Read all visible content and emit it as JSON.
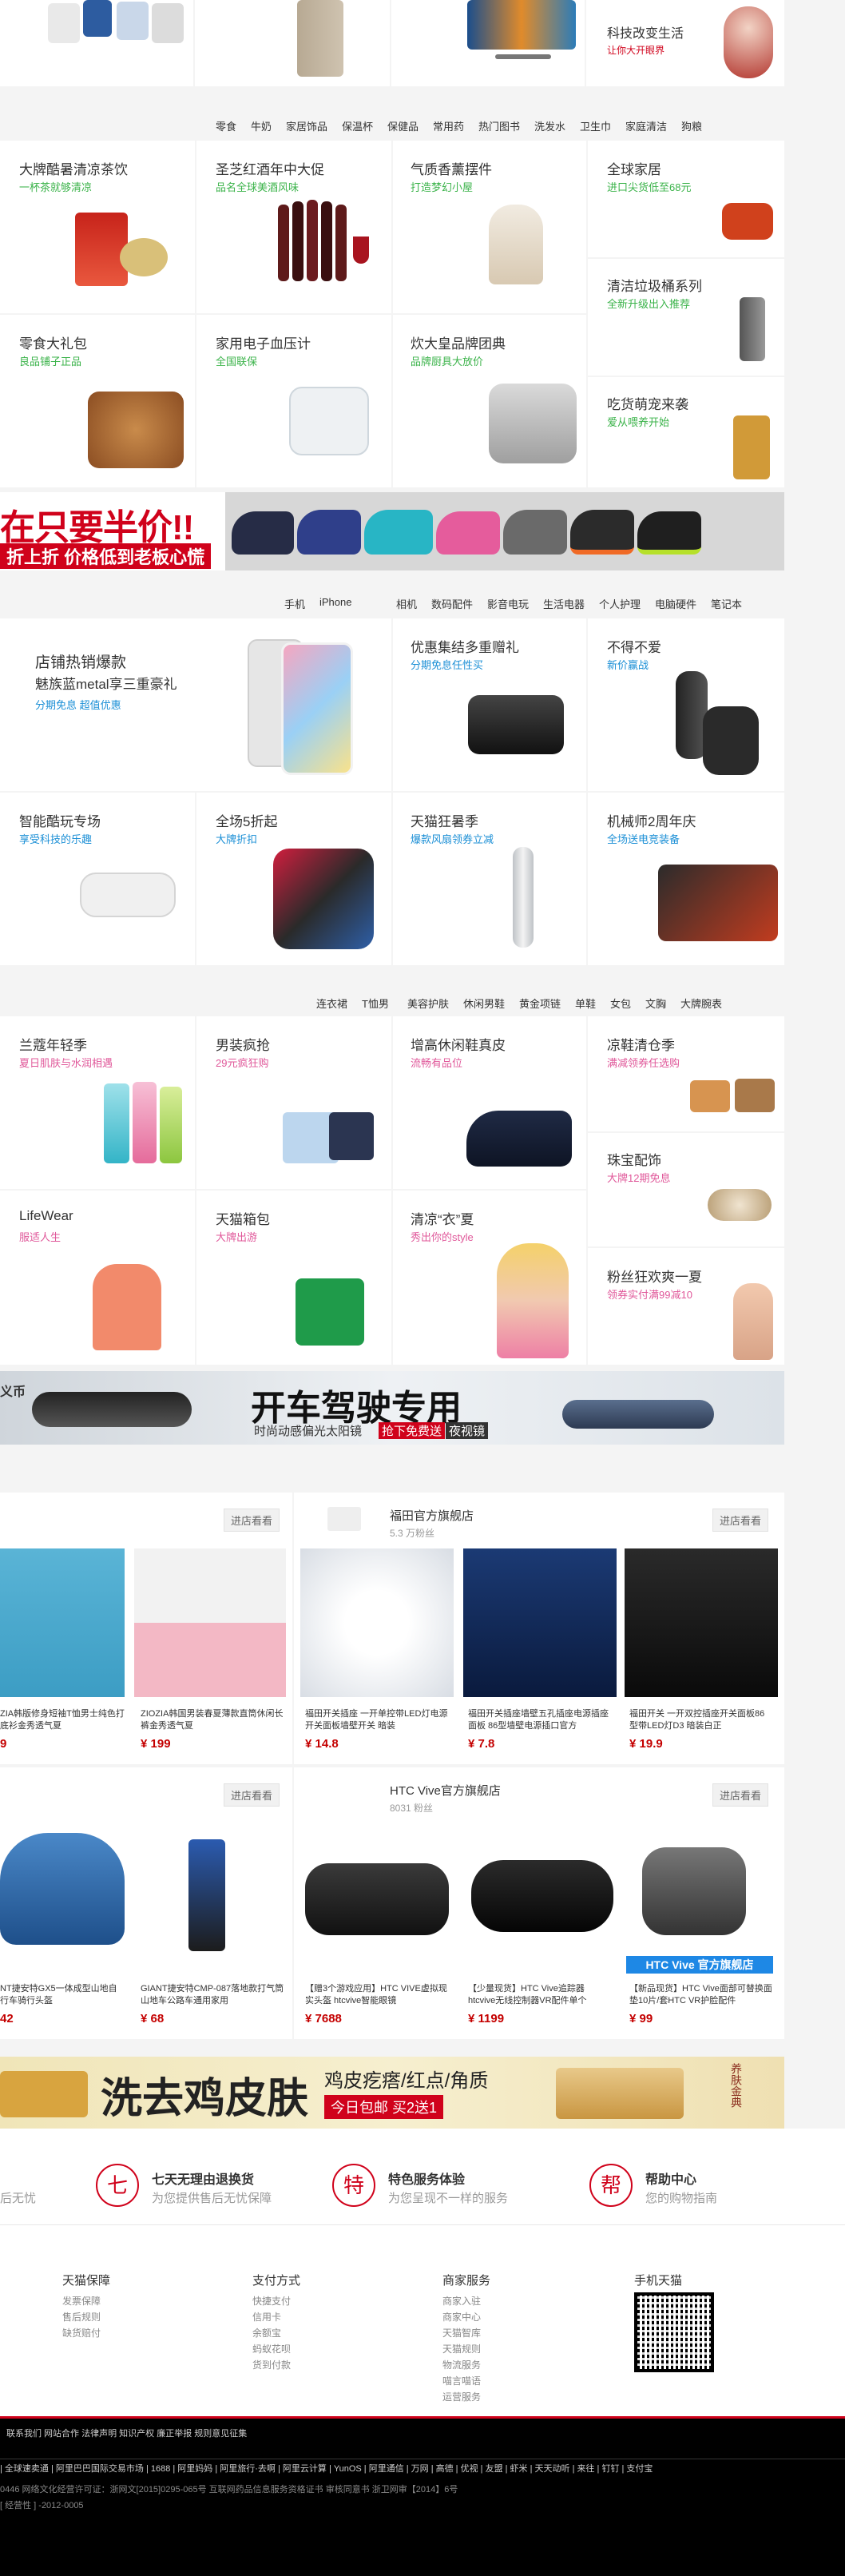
{
  "top_banner": {
    "title": "科技改变生活",
    "subtitle": "让你大开眼界"
  },
  "row1_cats": [
    "零食",
    "牛奶",
    "家居饰品",
    "保温杯",
    "保健品",
    "常用药",
    "热门图书",
    "洗发水",
    "卫生巾",
    "家庭清洁",
    "狗粮"
  ],
  "grid1": [
    {
      "title": "大牌酷暑清凉茶饮",
      "sub": "一杯茶就够清凉"
    },
    {
      "title": "圣芝红酒年中大促",
      "sub": "品名全球美酒风味"
    },
    {
      "title": "气质香薰摆件",
      "sub": "打造梦幻小屋"
    },
    {
      "title": "全球家居",
      "sub": "进口尖货低至68元"
    },
    {
      "title": "清洁垃圾桶系列",
      "sub": "全新升级出入推荐"
    },
    {
      "title": "零食大礼包",
      "sub": "良品铺子正品"
    },
    {
      "title": "家用电子血压计",
      "sub": "全国联保"
    },
    {
      "title": "炊大皇品牌团典",
      "sub": "品牌厨具大放价"
    },
    {
      "title": "吃货萌宠来袭",
      "sub": "爱从喂养开始"
    }
  ],
  "shoe_banner": {
    "line1": "在只要半价!!",
    "line2": "折上折 价格低到老板心慌"
  },
  "row2_cats": [
    "手机",
    "iPhone",
    "相机",
    "数码配件",
    "影音电玩",
    "生活电器",
    "个人护理",
    "电脑硬件",
    "笔记本"
  ],
  "grid2": [
    {
      "title": "店铺热销爆款",
      "title2": "魅族蓝metal享三重豪礼",
      "sub": "分期免息 超值优惠"
    },
    {
      "title": "优惠集结多重赠礼",
      "sub": "分期免息任性买"
    },
    {
      "title": "不得不爱",
      "sub": "新价赢战"
    },
    {
      "title": "智能酷玩专场",
      "sub": "享受科技的乐趣"
    },
    {
      "title": "全场5折起",
      "sub": "大牌折扣"
    },
    {
      "title": "天猫狂暑季",
      "sub": "爆款风扇领券立减"
    },
    {
      "title": "机械师2周年庆",
      "sub": "全场送电竞装备"
    }
  ],
  "row3_cats": [
    "连衣裙",
    "T恤男",
    "美容护肤",
    "休闲男鞋",
    "黄金项链",
    "单鞋",
    "女包",
    "文胸",
    "大牌腕表"
  ],
  "grid3": [
    {
      "title": "兰蔻年轻季",
      "sub": "夏日肌肤与水润相遇"
    },
    {
      "title": "男装疯抢",
      "sub": "29元疯狂购"
    },
    {
      "title": "增高休闲鞋真皮",
      "sub": "流畅有品位"
    },
    {
      "title": "凉鞋清仓季",
      "sub": "满减领券任选购"
    },
    {
      "title": "珠宝配饰",
      "sub": "大牌12期免息"
    },
    {
      "title": "LifeWear",
      "sub": "服适人生"
    },
    {
      "title": "天猫箱包",
      "sub": "大牌出游"
    },
    {
      "title": "清凉“衣”夏",
      "sub": "秀出你的style"
    },
    {
      "title": "粉丝狂欢爽一夏",
      "sub": "领券实付满99减10"
    }
  ],
  "drive_banner": {
    "title": "开车驾驶专用",
    "sub": "时尚动感偏光太阳镜",
    "tag": "抢下免费送",
    "tag2": "夜视镜",
    "left": "义币"
  },
  "shops": [
    {
      "name": "",
      "fans": "",
      "btn": "进店看看",
      "products": [
        {
          "desc": "ZIA韩版修身短袖T恤男士纯色打底衫金秀透气夏",
          "price": "9"
        },
        {
          "desc": "ZIOZIA韩国男装春夏薄款直筒休闲长裤金秀透气夏",
          "price": "¥ 199"
        }
      ]
    },
    {
      "name": "福田官方旗舰店",
      "fans": "5.3 万粉丝",
      "btn": "进店看看",
      "products": [
        {
          "desc": "福田开关插座 一开单控带LED灯电源开关面板墙壁开关 暗装",
          "price": "¥ 14.8"
        },
        {
          "desc": "福田开关插座墙壁五孔插座电源插座面板 86型墙壁电源插口官方",
          "price": "¥ 7.8"
        },
        {
          "desc": "福田开关 一开双控插座开关面板86型带LED灯D3 暗装白正",
          "price": "¥ 19.9"
        }
      ]
    },
    {
      "name": "",
      "fans": "",
      "btn": "进店看看",
      "products": [
        {
          "desc": "NT捷安特GX5一体成型山地自行车骑行头盔",
          "price": "42"
        },
        {
          "desc": "GIANT捷安特CMP-087落地款打气筒山地车公路车通用家用",
          "price": "¥ 68"
        }
      ]
    },
    {
      "name": "HTC Vive官方旗舰店",
      "fans": "8031 粉丝",
      "btn": "进店看看",
      "products": [
        {
          "desc": "【赠3个游戏应用】HTC VIVE虚拟现实头盔 htcvive智能眼镜",
          "price": "¥ 7688"
        },
        {
          "desc": "【少量现货】HTC Vive追踪器 htcvive无线控制器VR配件单个",
          "price": "¥ 1199"
        },
        {
          "desc": "【新品现货】HTC Vive面部可替换面垫10片/套HTC VR护脸配件",
          "price": "¥ 99"
        }
      ]
    }
  ],
  "htc_badge": "HTC Vive 官方旗舰店",
  "soap_banner": {
    "title": "洗去鸡皮肤",
    "sub": "鸡皮疙瘩/红点/角质",
    "tag": "今日包邮 买2送1",
    "seal": "养肤金典"
  },
  "services": [
    {
      "icon": "七",
      "title": "七天无理由退换货",
      "sub": "为您提供售后无忧保障",
      "partial": "后无忧"
    },
    {
      "icon": "特",
      "title": "特色服务体验",
      "sub": "为您呈现不一样的服务"
    },
    {
      "icon": "帮",
      "title": "帮助中心",
      "sub": "您的购物指南"
    }
  ],
  "footer_cols": [
    {
      "title": "天猫保障",
      "items": [
        "发票保障",
        "售后规则",
        "缺货赔付"
      ]
    },
    {
      "title": "支付方式",
      "items": [
        "快捷支付",
        "信用卡",
        "余额宝",
        "蚂蚁花呗",
        "货到付款"
      ]
    },
    {
      "title": "商家服务",
      "items": [
        "商家入驻",
        "商家中心",
        "天猫智库",
        "天猫规则",
        "物流服务",
        "喵言喵语",
        "运营服务"
      ]
    },
    {
      "title": "手机天猫",
      "items": []
    }
  ],
  "bottom_links1": "联系我们  网站合作  法律声明  知识产权  廉正举报  规则意见征集",
  "bottom_links2": "| 全球速卖通 | 阿里巴巴国际交易市场 | 1688 | 阿里妈妈 | 阿里旅行·去啊 | 阿里云计算 | YunOS | 阿里通信 | 万网 | 高德 | 优视 | 友盟 | 虾米 | 天天动听 | 来往 | 钉钉 | 支付宝",
  "bottom_line3": "0446      网络文化经营许可证：浙网文[2015]0295-065号                          互联网药品信息服务资格证书 审核同意书 浙卫网审【2014】6号",
  "bottom_line4": "[ 经营性 ] -2012-0005"
}
